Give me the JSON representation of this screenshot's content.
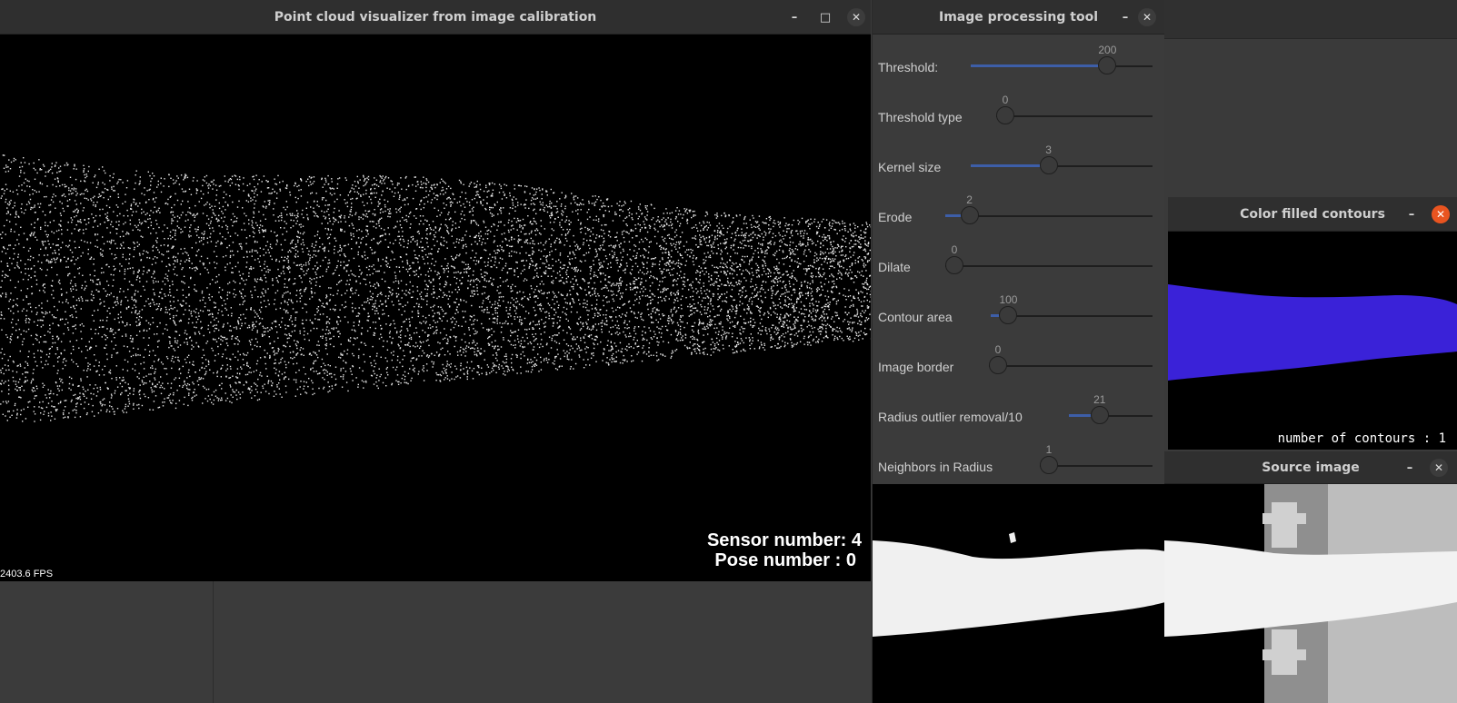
{
  "point_cloud_window": {
    "title": "Point cloud visualizer from image calibration",
    "sensor_label": "Sensor number: 4",
    "pose_label": "Pose number : 0",
    "fps": "2403.6 FPS"
  },
  "image_processing_tool": {
    "title": "Image processing tool",
    "sliders": [
      {
        "label": "Threshold:",
        "value": "200",
        "fraction": 0.78
      },
      {
        "label": "Threshold type",
        "value": "0",
        "fraction": 0.0
      },
      {
        "label": "Kernel size",
        "value": "3",
        "fraction": 0.42
      },
      {
        "label": "Erode",
        "value": "2",
        "fraction": 0.08
      },
      {
        "label": "Dilate",
        "value": "0",
        "fraction": 0.0
      },
      {
        "label": "Contour area",
        "value": "100",
        "fraction": 0.06
      },
      {
        "label": "Image border",
        "value": "0",
        "fraction": 0.0
      },
      {
        "label": "Radius outlier removal/10",
        "value": "21",
        "fraction": 0.33
      },
      {
        "label": "Neighbors in Radius",
        "value": "1",
        "fraction": 0.0
      }
    ]
  },
  "color_filled_contours": {
    "title": "Color filled contours",
    "count_label": "number of contours : 1",
    "fill_color": "#3a22d8"
  },
  "source_image": {
    "title": "Source image"
  },
  "window_buttons": {
    "minimize": "–",
    "maximize": "□",
    "close": "✕"
  }
}
